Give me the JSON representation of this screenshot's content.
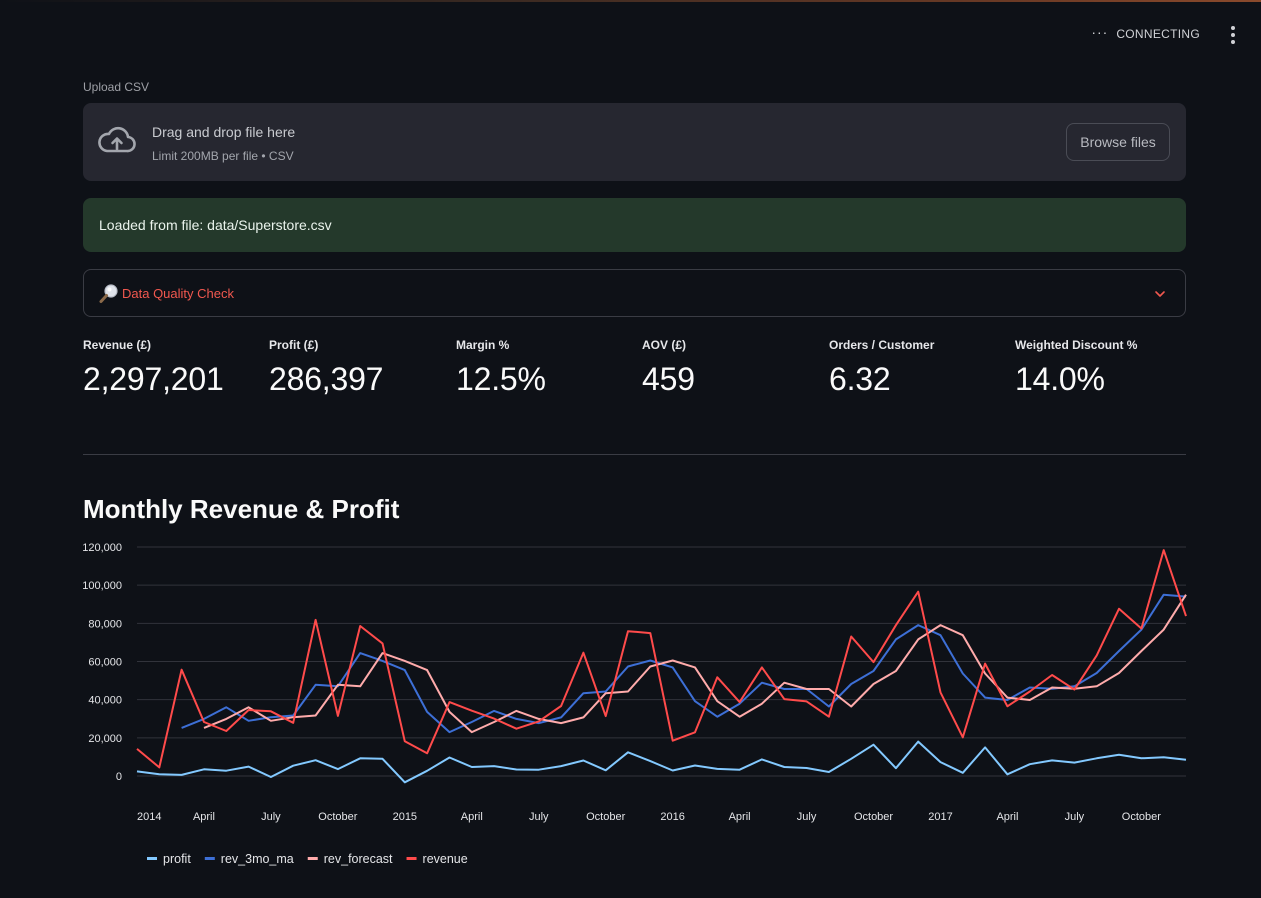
{
  "header": {
    "status_text": "CONNECTING"
  },
  "uploader": {
    "label": "Upload CSV",
    "drop_title": "Drag and drop file here",
    "drop_subtitle": "Limit 200MB per file • CSV",
    "browse_label": "Browse files"
  },
  "alert": {
    "text": "Loaded from file: data/Superstore.csv"
  },
  "expander": {
    "label": "Data Quality Check",
    "icon": "magnifier-icon"
  },
  "metrics": [
    {
      "label": "Revenue (£)",
      "value": "2,297,201"
    },
    {
      "label": "Profit (£)",
      "value": "286,397"
    },
    {
      "label": "Margin %",
      "value": "12.5%"
    },
    {
      "label": "AOV (£)",
      "value": "459"
    },
    {
      "label": "Orders / Customer",
      "value": "6.32"
    },
    {
      "label": "Weighted Discount %",
      "value": "14.0%"
    }
  ],
  "section_title": "Monthly Revenue & Profit",
  "chart_data": {
    "type": "line",
    "x": [
      "2014-01",
      "2014-02",
      "2014-03",
      "2014-04",
      "2014-05",
      "2014-06",
      "2014-07",
      "2014-08",
      "2014-09",
      "2014-10",
      "2014-11",
      "2014-12",
      "2015-01",
      "2015-02",
      "2015-03",
      "2015-04",
      "2015-05",
      "2015-06",
      "2015-07",
      "2015-08",
      "2015-09",
      "2015-10",
      "2015-11",
      "2015-12",
      "2016-01",
      "2016-02",
      "2016-03",
      "2016-04",
      "2016-05",
      "2016-06",
      "2016-07",
      "2016-08",
      "2016-09",
      "2016-10",
      "2016-11",
      "2016-12",
      "2017-01",
      "2017-02",
      "2017-03",
      "2017-04",
      "2017-05",
      "2017-06",
      "2017-07",
      "2017-08",
      "2017-09",
      "2017-10",
      "2017-11",
      "2017-12"
    ],
    "x_tick_labels": [
      "2014",
      "April",
      "July",
      "October",
      "2015",
      "April",
      "July",
      "October",
      "2016",
      "April",
      "July",
      "October",
      "2017",
      "April",
      "July",
      "October"
    ],
    "y_tick_labels": [
      "0",
      "20,000",
      "40,000",
      "60,000",
      "80,000",
      "100,000",
      "120,000"
    ],
    "ylim": [
      0,
      120000
    ],
    "grid": true,
    "legend_position": "bottom-left",
    "series": [
      {
        "name": "profit",
        "color": "#83c9ff",
        "values": [
          2400,
          900,
          600,
          3500,
          2800,
          4900,
          -500,
          5400,
          8300,
          3600,
          9300,
          9000,
          -3300,
          2700,
          9700,
          4700,
          5200,
          3400,
          3300,
          5200,
          8100,
          3000,
          12400,
          7800,
          2900,
          5500,
          3700,
          3300,
          8700,
          4700,
          4200,
          2100,
          9000,
          16400,
          4100,
          18000,
          7300,
          1700,
          15000,
          900,
          6200,
          8200,
          7000,
          9300,
          11100,
          9300,
          9800,
          8500
        ]
      },
      {
        "name": "rev_3mo_ma",
        "color": "#3d6fd6",
        "values": [
          null,
          null,
          25200,
          29900,
          36000,
          28900,
          30800,
          31700,
          47800,
          47000,
          64400,
          60300,
          55500,
          33600,
          23000,
          28300,
          34100,
          29900,
          27700,
          30700,
          43400,
          44300,
          57400,
          60500,
          56900,
          39200,
          31100,
          37900,
          48900,
          45600,
          45600,
          36400,
          48200,
          55000,
          71600,
          79100,
          73800,
          53700,
          41100,
          39800,
          46400,
          45700,
          47000,
          54000,
          65500,
          76700,
          95000,
          94000
        ]
      },
      {
        "name": "rev_forecast",
        "color": "#ffabab",
        "values": [
          null,
          null,
          null,
          25200,
          29900,
          36000,
          28900,
          30800,
          31700,
          47800,
          47000,
          64400,
          60300,
          55500,
          33600,
          23000,
          28300,
          34100,
          29900,
          27700,
          30700,
          43400,
          44300,
          57400,
          60500,
          56900,
          39200,
          31100,
          37900,
          48900,
          45600,
          45600,
          36400,
          48200,
          55000,
          71600,
          79100,
          73800,
          53700,
          41100,
          39800,
          46400,
          45700,
          47000,
          54000,
          65500,
          76700,
          95000
        ]
      },
      {
        "name": "revenue",
        "color": "#ff4b4b",
        "values": [
          14200,
          4500,
          55700,
          28300,
          23600,
          34600,
          33900,
          27900,
          81800,
          31500,
          78600,
          69500,
          18200,
          11900,
          38700,
          34200,
          30100,
          24800,
          28600,
          36700,
          64600,
          31400,
          75900,
          74900,
          18500,
          22900,
          51700,
          38700,
          56900,
          40300,
          39100,
          31100,
          73100,
          59700,
          79000,
          96600,
          43800,
          20300,
          58900,
          36500,
          44300,
          52900,
          45300,
          63200,
          87600,
          77300,
          118400,
          83800
        ]
      }
    ]
  }
}
